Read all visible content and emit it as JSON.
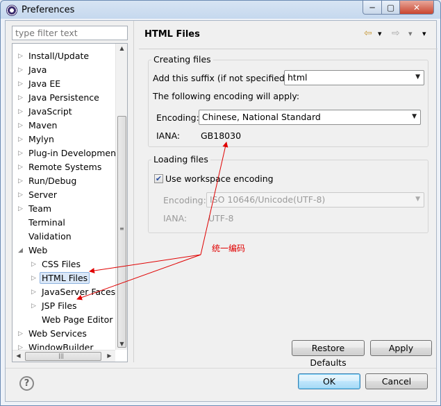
{
  "window": {
    "title": "Preferences"
  },
  "controls": {
    "minimize": "─",
    "maximize": "▢",
    "close": "✕"
  },
  "left": {
    "filter_placeholder": "type filter text",
    "tree_items": [
      {
        "label": "Install/Update",
        "level": 0,
        "expander": "collapsed"
      },
      {
        "label": "Java",
        "level": 0,
        "expander": "collapsed"
      },
      {
        "label": "Java EE",
        "level": 0,
        "expander": "collapsed"
      },
      {
        "label": "Java Persistence",
        "level": 0,
        "expander": "collapsed"
      },
      {
        "label": "JavaScript",
        "level": 0,
        "expander": "collapsed"
      },
      {
        "label": "Maven",
        "level": 0,
        "expander": "collapsed"
      },
      {
        "label": "Mylyn",
        "level": 0,
        "expander": "collapsed"
      },
      {
        "label": "Plug-in Development",
        "level": 0,
        "expander": "collapsed"
      },
      {
        "label": "Remote Systems",
        "level": 0,
        "expander": "collapsed"
      },
      {
        "label": "Run/Debug",
        "level": 0,
        "expander": "collapsed"
      },
      {
        "label": "Server",
        "level": 0,
        "expander": "collapsed"
      },
      {
        "label": "Team",
        "level": 0,
        "expander": "collapsed"
      },
      {
        "label": "Terminal",
        "level": 0,
        "expander": "none"
      },
      {
        "label": "Validation",
        "level": 0,
        "expander": "none"
      },
      {
        "label": "Web",
        "level": 0,
        "expander": "expanded"
      },
      {
        "label": "CSS Files",
        "level": 1,
        "expander": "collapsed"
      },
      {
        "label": "HTML Files",
        "level": 1,
        "expander": "collapsed",
        "selected": true
      },
      {
        "label": "JavaServer Faces T",
        "level": 1,
        "expander": "collapsed"
      },
      {
        "label": "JSP Files",
        "level": 1,
        "expander": "collapsed"
      },
      {
        "label": "Web Page Editor",
        "level": 1,
        "expander": "none"
      },
      {
        "label": "Web Services",
        "level": 0,
        "expander": "collapsed"
      },
      {
        "label": "WindowBuilder",
        "level": 0,
        "expander": "collapsed"
      }
    ]
  },
  "page": {
    "title": "HTML Files",
    "nav_back": "⇦",
    "nav_forward": "⇨",
    "dropdown": "▾",
    "creating": {
      "title": "Creating files",
      "suffix_label": "Add this suffix (if not specified):",
      "suffix_value": "html",
      "encoding_note": "The following encoding will apply:",
      "encoding_label": "Encoding:",
      "encoding_value": "Chinese, National Standard",
      "iana_label": "IANA:",
      "iana_value": "GB18030"
    },
    "loading": {
      "title": "Loading files",
      "use_workspace_label": "Use workspace encoding",
      "use_workspace_checked": true,
      "check_mark": "✔",
      "encoding_label": "Encoding:",
      "encoding_value": "ISO 10646/Unicode(UTF-8)",
      "iana_label": "IANA:",
      "iana_value": "UTF-8"
    },
    "restore_defaults": "Restore Defaults",
    "apply": "Apply"
  },
  "footer": {
    "help": "?",
    "ok": "OK",
    "cancel": "Cancel"
  },
  "annotation": {
    "text": "统一编码",
    "color": "#e00000"
  }
}
